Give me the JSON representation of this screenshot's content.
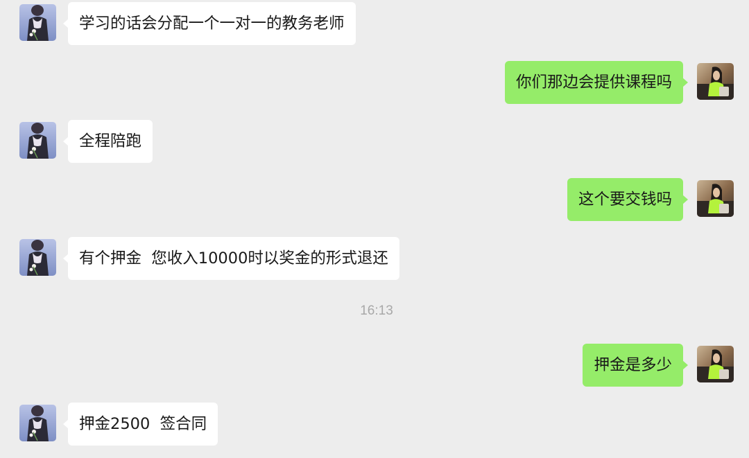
{
  "chat": {
    "messages": [
      {
        "side": "left",
        "sender": "contact",
        "text": "学习的话会分配一个一对一的教务老师"
      },
      {
        "side": "right",
        "sender": "self",
        "text": "你们那边会提供课程吗"
      },
      {
        "side": "left",
        "sender": "contact",
        "text": "全程陪跑"
      },
      {
        "side": "right",
        "sender": "self",
        "text": "这个要交钱吗"
      },
      {
        "side": "left",
        "sender": "contact",
        "text": "有个押金  您收入10000时以奖金的形式退还"
      },
      {
        "side": "right",
        "sender": "self",
        "text": "押金是多少"
      },
      {
        "side": "left",
        "sender": "contact",
        "text": "押金2500  签合同"
      }
    ],
    "timestamp": "16:13"
  },
  "colors": {
    "background": "#ededed",
    "incoming_bubble": "#ffffff",
    "outgoing_bubble": "#95ec69",
    "text": "#191919",
    "timestamp": "#a8a8a8"
  },
  "icons": {
    "contact_avatar": "contact-avatar-photo",
    "self_avatar": "self-avatar-photo"
  }
}
